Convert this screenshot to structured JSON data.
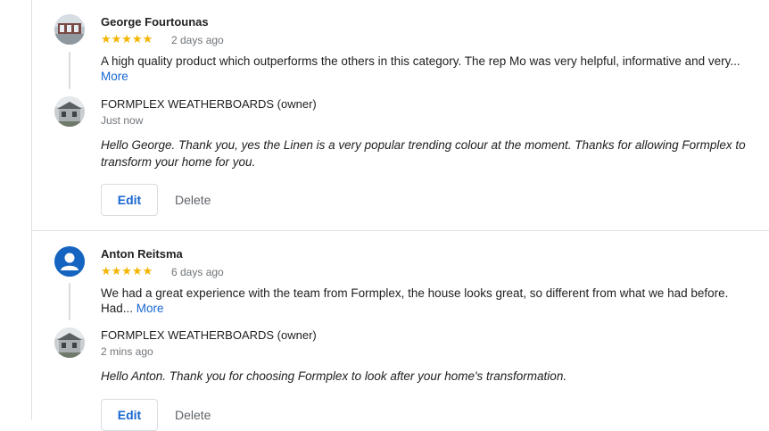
{
  "reviews": [
    {
      "author": "George Fourtounas",
      "stars": "★★★★★",
      "date": "2 days ago",
      "text": "A high quality product which outperforms the others in this category. The rep Mo was very helpful, informative and very...",
      "more_label": "More",
      "avatar_icon": "profile-photo-icon",
      "owner": {
        "name": "FORMPLEX WEATHERBOARDS (owner)",
        "time": "Just now",
        "reply": "Hello George. Thank you, yes the Linen is a very popular trending colour at the moment. Thanks for allowing Formplex to transform your home for you.",
        "avatar_icon": "house-photo-icon"
      },
      "edit_label": "Edit",
      "delete_label": "Delete"
    },
    {
      "author": "Anton Reitsma",
      "stars": "★★★★★",
      "date": "6 days ago",
      "text": "We had a great experience with the team from Formplex, the house looks great, so different from what we had before. Had...",
      "more_label": "More",
      "avatar_icon": "default-person-icon",
      "owner": {
        "name": "FORMPLEX WEATHERBOARDS (owner)",
        "time": "2 mins ago",
        "reply": "Hello Anton. Thank you for choosing Formplex to look after your home's transformation.",
        "avatar_icon": "house-photo-icon"
      },
      "edit_label": "Edit",
      "delete_label": "Delete"
    }
  ],
  "colors": {
    "star": "#f4b400",
    "link": "#1967d2",
    "default_avatar": "#1565c0",
    "divider": "#e0e0e0"
  }
}
